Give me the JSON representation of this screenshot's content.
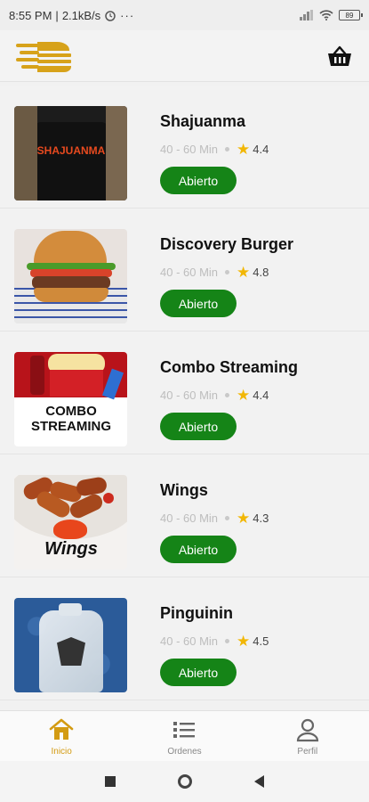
{
  "status_bar": {
    "time": "8:55 PM",
    "speed": "2.1kB/s",
    "battery": "89"
  },
  "header": {
    "logo_icon": "burger-logo-icon",
    "cart_icon": "basket-icon"
  },
  "restaurants": [
    {
      "name": "Shajuanma",
      "time": "40 - 60 Min",
      "rating": "4.4",
      "status": "Abierto",
      "thumb_text": "SHAJUANMA"
    },
    {
      "name": "Discovery Burger",
      "time": "40 - 60 Min",
      "rating": "4.8",
      "status": "Abierto",
      "thumb_text": ""
    },
    {
      "name": "Combo Streaming",
      "time": "40 - 60 Min",
      "rating": "4.4",
      "status": "Abierto",
      "thumb_text": "COMBO STREAMING"
    },
    {
      "name": "Wings",
      "time": "40 - 60 Min",
      "rating": "4.3",
      "status": "Abierto",
      "thumb_text": "Wings"
    },
    {
      "name": "Pinguinin",
      "time": "40 - 60 Min",
      "rating": "4.5",
      "status": "Abierto",
      "thumb_text": ""
    }
  ],
  "bottom_nav": [
    {
      "label": "Inicio",
      "icon": "home-icon",
      "active": true
    },
    {
      "label": "Ordenes",
      "icon": "list-icon",
      "active": false
    },
    {
      "label": "Perfil",
      "icon": "user-icon",
      "active": false
    }
  ],
  "colors": {
    "accent": "#d39b12",
    "button_green": "#158417",
    "star": "#f2b705"
  }
}
